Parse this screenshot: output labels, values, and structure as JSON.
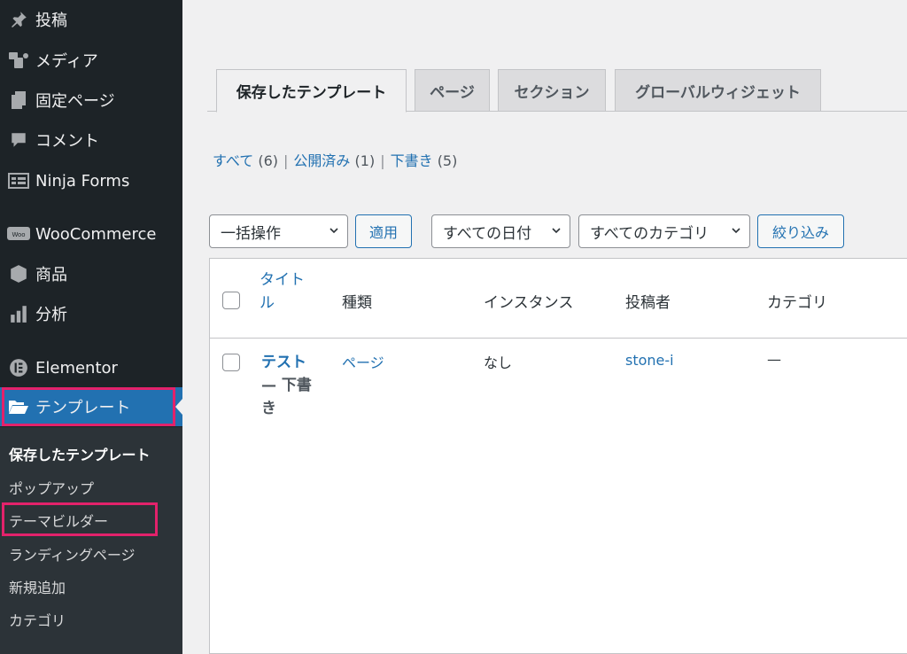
{
  "sidebar": {
    "items": [
      {
        "label": "投稿",
        "icon": "pin-icon"
      },
      {
        "label": "メディア",
        "icon": "media-icon"
      },
      {
        "label": "固定ページ",
        "icon": "pages-icon"
      },
      {
        "label": "コメント",
        "icon": "comments-icon"
      },
      {
        "label": "Ninja Forms",
        "icon": "forms-icon"
      },
      {
        "label": "WooCommerce",
        "icon": "woo-icon"
      },
      {
        "label": "商品",
        "icon": "box-icon"
      },
      {
        "label": "分析",
        "icon": "chart-icon"
      },
      {
        "label": "Elementor",
        "icon": "elementor-icon"
      },
      {
        "label": "テンプレート",
        "icon": "folder-icon"
      }
    ],
    "submenu": [
      "保存したテンプレート",
      "ポップアップ",
      "テーマビルダー",
      "ランディングページ",
      "新規追加",
      "カテゴリ"
    ]
  },
  "tabs": [
    "保存したテンプレート",
    "ページ",
    "セクション",
    "グローバルウィジェット"
  ],
  "filters": {
    "all": "すべて",
    "all_count": "(6)",
    "published": "公開済み",
    "published_count": "(1)",
    "draft": "下書き",
    "draft_count": "(5)",
    "sep": "|"
  },
  "toolbar": {
    "bulk": "一括操作",
    "apply": "適用",
    "dates": "すべての日付",
    "categories": "すべてのカテゴリ",
    "filter": "絞り込み"
  },
  "table": {
    "headers": {
      "title_line1": "タイト",
      "title_line2": "ル",
      "type": "種類",
      "instances": "インスタンス",
      "author": "投稿者",
      "category": "カテゴリ"
    },
    "rows": [
      {
        "title": "テスト",
        "state": "— 下書き",
        "type": "ページ",
        "instances": "なし",
        "author": "stone-i",
        "category": "—"
      }
    ]
  },
  "colors": {
    "accent": "#2271b1",
    "highlight": "#e3226b",
    "sidebar": "#1d2327"
  }
}
